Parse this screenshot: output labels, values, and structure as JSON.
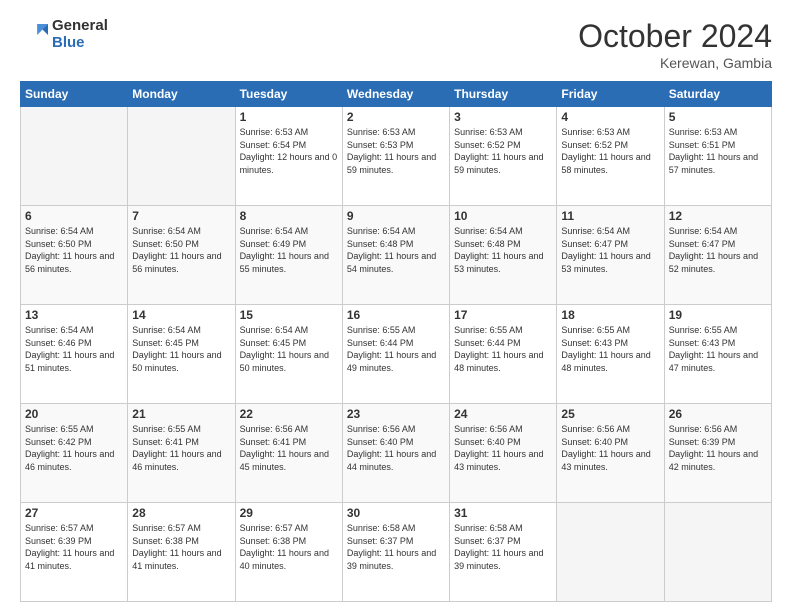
{
  "header": {
    "logo_general": "General",
    "logo_blue": "Blue",
    "title": "October 2024",
    "location": "Kerewan, Gambia"
  },
  "days_of_week": [
    "Sunday",
    "Monday",
    "Tuesday",
    "Wednesday",
    "Thursday",
    "Friday",
    "Saturday"
  ],
  "weeks": [
    [
      {
        "day": "",
        "info": ""
      },
      {
        "day": "",
        "info": ""
      },
      {
        "day": "1",
        "info": "Sunrise: 6:53 AM\nSunset: 6:54 PM\nDaylight: 12 hours\nand 0 minutes."
      },
      {
        "day": "2",
        "info": "Sunrise: 6:53 AM\nSunset: 6:53 PM\nDaylight: 11 hours\nand 59 minutes."
      },
      {
        "day": "3",
        "info": "Sunrise: 6:53 AM\nSunset: 6:52 PM\nDaylight: 11 hours\nand 59 minutes."
      },
      {
        "day": "4",
        "info": "Sunrise: 6:53 AM\nSunset: 6:52 PM\nDaylight: 11 hours\nand 58 minutes."
      },
      {
        "day": "5",
        "info": "Sunrise: 6:53 AM\nSunset: 6:51 PM\nDaylight: 11 hours\nand 57 minutes."
      }
    ],
    [
      {
        "day": "6",
        "info": "Sunrise: 6:54 AM\nSunset: 6:50 PM\nDaylight: 11 hours\nand 56 minutes."
      },
      {
        "day": "7",
        "info": "Sunrise: 6:54 AM\nSunset: 6:50 PM\nDaylight: 11 hours\nand 56 minutes."
      },
      {
        "day": "8",
        "info": "Sunrise: 6:54 AM\nSunset: 6:49 PM\nDaylight: 11 hours\nand 55 minutes."
      },
      {
        "day": "9",
        "info": "Sunrise: 6:54 AM\nSunset: 6:48 PM\nDaylight: 11 hours\nand 54 minutes."
      },
      {
        "day": "10",
        "info": "Sunrise: 6:54 AM\nSunset: 6:48 PM\nDaylight: 11 hours\nand 53 minutes."
      },
      {
        "day": "11",
        "info": "Sunrise: 6:54 AM\nSunset: 6:47 PM\nDaylight: 11 hours\nand 53 minutes."
      },
      {
        "day": "12",
        "info": "Sunrise: 6:54 AM\nSunset: 6:47 PM\nDaylight: 11 hours\nand 52 minutes."
      }
    ],
    [
      {
        "day": "13",
        "info": "Sunrise: 6:54 AM\nSunset: 6:46 PM\nDaylight: 11 hours\nand 51 minutes."
      },
      {
        "day": "14",
        "info": "Sunrise: 6:54 AM\nSunset: 6:45 PM\nDaylight: 11 hours\nand 50 minutes."
      },
      {
        "day": "15",
        "info": "Sunrise: 6:54 AM\nSunset: 6:45 PM\nDaylight: 11 hours\nand 50 minutes."
      },
      {
        "day": "16",
        "info": "Sunrise: 6:55 AM\nSunset: 6:44 PM\nDaylight: 11 hours\nand 49 minutes."
      },
      {
        "day": "17",
        "info": "Sunrise: 6:55 AM\nSunset: 6:44 PM\nDaylight: 11 hours\nand 48 minutes."
      },
      {
        "day": "18",
        "info": "Sunrise: 6:55 AM\nSunset: 6:43 PM\nDaylight: 11 hours\nand 48 minutes."
      },
      {
        "day": "19",
        "info": "Sunrise: 6:55 AM\nSunset: 6:43 PM\nDaylight: 11 hours\nand 47 minutes."
      }
    ],
    [
      {
        "day": "20",
        "info": "Sunrise: 6:55 AM\nSunset: 6:42 PM\nDaylight: 11 hours\nand 46 minutes."
      },
      {
        "day": "21",
        "info": "Sunrise: 6:55 AM\nSunset: 6:41 PM\nDaylight: 11 hours\nand 46 minutes."
      },
      {
        "day": "22",
        "info": "Sunrise: 6:56 AM\nSunset: 6:41 PM\nDaylight: 11 hours\nand 45 minutes."
      },
      {
        "day": "23",
        "info": "Sunrise: 6:56 AM\nSunset: 6:40 PM\nDaylight: 11 hours\nand 44 minutes."
      },
      {
        "day": "24",
        "info": "Sunrise: 6:56 AM\nSunset: 6:40 PM\nDaylight: 11 hours\nand 43 minutes."
      },
      {
        "day": "25",
        "info": "Sunrise: 6:56 AM\nSunset: 6:40 PM\nDaylight: 11 hours\nand 43 minutes."
      },
      {
        "day": "26",
        "info": "Sunrise: 6:56 AM\nSunset: 6:39 PM\nDaylight: 11 hours\nand 42 minutes."
      }
    ],
    [
      {
        "day": "27",
        "info": "Sunrise: 6:57 AM\nSunset: 6:39 PM\nDaylight: 11 hours\nand 41 minutes."
      },
      {
        "day": "28",
        "info": "Sunrise: 6:57 AM\nSunset: 6:38 PM\nDaylight: 11 hours\nand 41 minutes."
      },
      {
        "day": "29",
        "info": "Sunrise: 6:57 AM\nSunset: 6:38 PM\nDaylight: 11 hours\nand 40 minutes."
      },
      {
        "day": "30",
        "info": "Sunrise: 6:58 AM\nSunset: 6:37 PM\nDaylight: 11 hours\nand 39 minutes."
      },
      {
        "day": "31",
        "info": "Sunrise: 6:58 AM\nSunset: 6:37 PM\nDaylight: 11 hours\nand 39 minutes."
      },
      {
        "day": "",
        "info": ""
      },
      {
        "day": "",
        "info": ""
      }
    ]
  ]
}
